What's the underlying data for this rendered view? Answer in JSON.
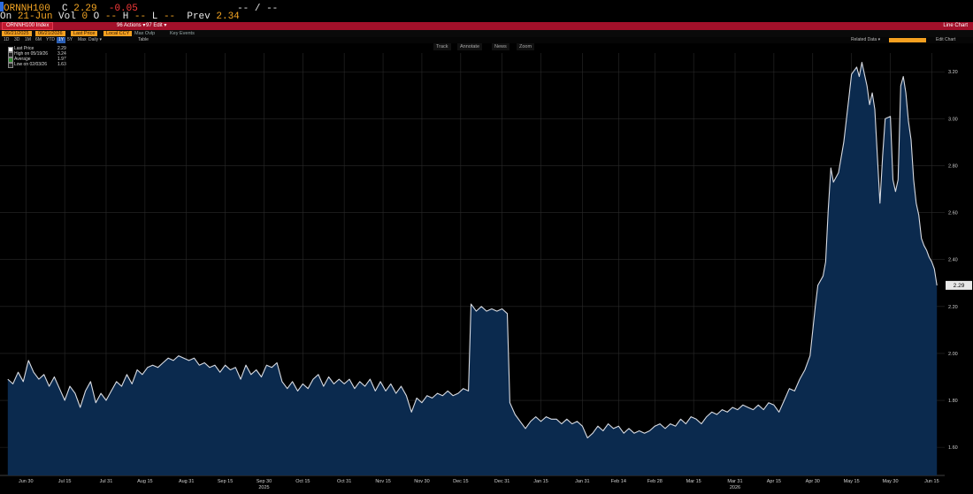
{
  "quote": {
    "ticker": "ORNNH100",
    "c_label": "C",
    "last": "2.29",
    "change": "-0.05",
    "bidask": "-- / --",
    "on_label": "On",
    "date": "21-Jun",
    "vol_label": "Vol",
    "vol": "0",
    "open_label": "O",
    "open": "--",
    "high_label": "H",
    "high": "--",
    "low_label": "L",
    "low": "--",
    "prev_label": "Prev",
    "prev": "2.34"
  },
  "menubar": {
    "ticker_box": "ORNNH100 Index",
    "actions": "96 Actions ▾",
    "edit": "97 Edit ▾",
    "right_title": "Line Chart"
  },
  "dates_row": {
    "start": "06/21/2025",
    "end": "06/21/2026",
    "last_price": "Last Price",
    "local_ccy": "Local CCY",
    "max_ovlp": "Max Ovlp",
    "key_events": "Key Events"
  },
  "periods": [
    "1D",
    "3D",
    "1M",
    "6M",
    "YTD",
    "1Y",
    "5Y",
    "Max",
    "Daily ▾",
    "",
    "Table"
  ],
  "periods_selected_index": 5,
  "right_controls": {
    "related": "Related Data ▾",
    "edit_chart": "Edit Chart"
  },
  "toolbar": [
    "Track",
    "Annotate",
    "News",
    "Zoom"
  ],
  "legend": [
    {
      "label": "Last Price",
      "value": "2.29",
      "color": "#ffffff"
    },
    {
      "label": "High on 05/19/26",
      "value": "3.24",
      "color": "#222222"
    },
    {
      "label": "Average",
      "value": "1.97",
      "color": "#2d8a2d"
    },
    {
      "label": "Low on 02/03/26",
      "value": "1.63",
      "color": "#222222"
    }
  ],
  "colors": {
    "line": "#d8dbe2",
    "fill": "#0b2a4e",
    "last_tag_bg": "#e8e8e8",
    "accent_amber": "#f5a623",
    "change_red": "#ff3b3b"
  },
  "chart_data": {
    "type": "area",
    "title": "",
    "xlabel": "",
    "ylabel": "",
    "ylim": [
      1.48,
      3.28
    ],
    "yticks": [
      1.6,
      1.8,
      2.0,
      2.2,
      2.4,
      2.6,
      2.8,
      3.0,
      3.2
    ],
    "ytick_labels": [
      "1.60",
      "1.80",
      "2.00",
      "2.20",
      "2.40",
      "2.60",
      "2.80",
      "3.00",
      "3.20"
    ],
    "xtick_labels": [
      "Jun 30",
      "Jul 15",
      "Jul 31",
      "Aug 15",
      "Aug 31",
      "Sep 15",
      "Sep 30",
      "Oct 15",
      "Oct 31",
      "Nov 15",
      "Nov 30",
      "Dec 15",
      "Dec 31",
      "Jan 15",
      "Jan 31",
      "Feb 14",
      "Feb 28",
      "Mar 15",
      "Mar 31",
      "Apr 15",
      "Apr 30",
      "May 15",
      "May 30",
      "Jun 15"
    ],
    "xtick_dates": [
      "2025-06-30",
      "2025-07-15",
      "2025-07-31",
      "2025-08-15",
      "2025-08-31",
      "2025-09-15",
      "2025-09-30",
      "2025-10-15",
      "2025-10-31",
      "2025-11-15",
      "2025-11-30",
      "2025-12-15",
      "2025-12-31",
      "2026-01-15",
      "2026-01-31",
      "2026-02-14",
      "2026-02-28",
      "2026-03-15",
      "2026-03-31",
      "2026-04-15",
      "2026-04-30",
      "2026-05-15",
      "2026-05-30",
      "2026-06-15"
    ],
    "year_labels": [
      {
        "label": "2025",
        "date": "2025-09-30"
      },
      {
        "label": "2026",
        "date": "2026-03-31"
      }
    ],
    "last_value_tag": "2.29",
    "series": [
      {
        "values": [
          [
            "2025-06-23",
            1.89
          ],
          [
            "2025-06-25",
            1.87
          ],
          [
            "2025-06-27",
            1.92
          ],
          [
            "2025-06-29",
            1.88
          ],
          [
            "2025-07-01",
            1.97
          ],
          [
            "2025-07-03",
            1.92
          ],
          [
            "2025-07-05",
            1.89
          ],
          [
            "2025-07-07",
            1.91
          ],
          [
            "2025-07-09",
            1.86
          ],
          [
            "2025-07-11",
            1.9
          ],
          [
            "2025-07-13",
            1.85
          ],
          [
            "2025-07-15",
            1.8
          ],
          [
            "2025-07-17",
            1.86
          ],
          [
            "2025-07-19",
            1.83
          ],
          [
            "2025-07-21",
            1.77
          ],
          [
            "2025-07-23",
            1.84
          ],
          [
            "2025-07-25",
            1.88
          ],
          [
            "2025-07-27",
            1.79
          ],
          [
            "2025-07-29",
            1.83
          ],
          [
            "2025-07-31",
            1.8
          ],
          [
            "2025-08-02",
            1.84
          ],
          [
            "2025-08-04",
            1.88
          ],
          [
            "2025-08-06",
            1.86
          ],
          [
            "2025-08-08",
            1.91
          ],
          [
            "2025-08-10",
            1.87
          ],
          [
            "2025-08-12",
            1.93
          ],
          [
            "2025-08-14",
            1.91
          ],
          [
            "2025-08-16",
            1.94
          ],
          [
            "2025-08-18",
            1.95
          ],
          [
            "2025-08-20",
            1.94
          ],
          [
            "2025-08-22",
            1.96
          ],
          [
            "2025-08-24",
            1.98
          ],
          [
            "2025-08-26",
            1.97
          ],
          [
            "2025-08-28",
            1.99
          ],
          [
            "2025-08-30",
            1.98
          ],
          [
            "2025-09-01",
            1.97
          ],
          [
            "2025-09-03",
            1.98
          ],
          [
            "2025-09-05",
            1.95
          ],
          [
            "2025-09-07",
            1.96
          ],
          [
            "2025-09-09",
            1.94
          ],
          [
            "2025-09-11",
            1.95
          ],
          [
            "2025-09-13",
            1.92
          ],
          [
            "2025-09-15",
            1.95
          ],
          [
            "2025-09-17",
            1.93
          ],
          [
            "2025-09-19",
            1.94
          ],
          [
            "2025-09-21",
            1.89
          ],
          [
            "2025-09-23",
            1.95
          ],
          [
            "2025-09-25",
            1.91
          ],
          [
            "2025-09-27",
            1.93
          ],
          [
            "2025-09-29",
            1.9
          ],
          [
            "2025-10-01",
            1.95
          ],
          [
            "2025-10-03",
            1.94
          ],
          [
            "2025-10-05",
            1.96
          ],
          [
            "2025-10-07",
            1.88
          ],
          [
            "2025-10-09",
            1.85
          ],
          [
            "2025-10-11",
            1.88
          ],
          [
            "2025-10-13",
            1.84
          ],
          [
            "2025-10-15",
            1.87
          ],
          [
            "2025-10-17",
            1.85
          ],
          [
            "2025-10-19",
            1.89
          ],
          [
            "2025-10-21",
            1.91
          ],
          [
            "2025-10-23",
            1.86
          ],
          [
            "2025-10-25",
            1.9
          ],
          [
            "2025-10-27",
            1.87
          ],
          [
            "2025-10-29",
            1.89
          ],
          [
            "2025-10-31",
            1.87
          ],
          [
            "2025-11-02",
            1.89
          ],
          [
            "2025-11-04",
            1.85
          ],
          [
            "2025-11-06",
            1.88
          ],
          [
            "2025-11-08",
            1.86
          ],
          [
            "2025-11-10",
            1.89
          ],
          [
            "2025-11-12",
            1.84
          ],
          [
            "2025-11-14",
            1.88
          ],
          [
            "2025-11-16",
            1.84
          ],
          [
            "2025-11-18",
            1.87
          ],
          [
            "2025-11-20",
            1.83
          ],
          [
            "2025-11-22",
            1.86
          ],
          [
            "2025-11-24",
            1.82
          ],
          [
            "2025-11-26",
            1.75
          ],
          [
            "2025-11-28",
            1.81
          ],
          [
            "2025-11-30",
            1.79
          ],
          [
            "2025-12-02",
            1.82
          ],
          [
            "2025-12-04",
            1.81
          ],
          [
            "2025-12-06",
            1.83
          ],
          [
            "2025-12-08",
            1.82
          ],
          [
            "2025-12-10",
            1.84
          ],
          [
            "2025-12-12",
            1.82
          ],
          [
            "2025-12-14",
            1.83
          ],
          [
            "2025-12-16",
            1.85
          ],
          [
            "2025-12-18",
            1.84
          ],
          [
            "2025-12-19",
            2.21
          ],
          [
            "2025-12-21",
            2.18
          ],
          [
            "2025-12-23",
            2.2
          ],
          [
            "2025-12-25",
            2.18
          ],
          [
            "2025-12-27",
            2.19
          ],
          [
            "2025-12-29",
            2.18
          ],
          [
            "2025-12-31",
            2.19
          ],
          [
            "2026-01-02",
            2.17
          ],
          [
            "2026-01-03",
            1.79
          ],
          [
            "2026-01-05",
            1.74
          ],
          [
            "2026-01-07",
            1.71
          ],
          [
            "2026-01-09",
            1.68
          ],
          [
            "2026-01-11",
            1.71
          ],
          [
            "2026-01-13",
            1.73
          ],
          [
            "2026-01-15",
            1.71
          ],
          [
            "2026-01-17",
            1.73
          ],
          [
            "2026-01-19",
            1.72
          ],
          [
            "2026-01-21",
            1.72
          ],
          [
            "2026-01-23",
            1.7
          ],
          [
            "2026-01-25",
            1.72
          ],
          [
            "2026-01-27",
            1.7
          ],
          [
            "2026-01-29",
            1.71
          ],
          [
            "2026-01-31",
            1.69
          ],
          [
            "2026-02-02",
            1.64
          ],
          [
            "2026-02-04",
            1.66
          ],
          [
            "2026-02-06",
            1.69
          ],
          [
            "2026-02-08",
            1.67
          ],
          [
            "2026-02-10",
            1.7
          ],
          [
            "2026-02-12",
            1.68
          ],
          [
            "2026-02-14",
            1.69
          ],
          [
            "2026-02-16",
            1.66
          ],
          [
            "2026-02-18",
            1.68
          ],
          [
            "2026-02-20",
            1.66
          ],
          [
            "2026-02-22",
            1.67
          ],
          [
            "2026-02-24",
            1.66
          ],
          [
            "2026-02-26",
            1.67
          ],
          [
            "2026-02-28",
            1.69
          ],
          [
            "2026-03-02",
            1.7
          ],
          [
            "2026-03-04",
            1.68
          ],
          [
            "2026-03-06",
            1.7
          ],
          [
            "2026-03-08",
            1.69
          ],
          [
            "2026-03-10",
            1.72
          ],
          [
            "2026-03-12",
            1.7
          ],
          [
            "2026-03-14",
            1.73
          ],
          [
            "2026-03-16",
            1.72
          ],
          [
            "2026-03-18",
            1.7
          ],
          [
            "2026-03-20",
            1.73
          ],
          [
            "2026-03-22",
            1.75
          ],
          [
            "2026-03-24",
            1.74
          ],
          [
            "2026-03-26",
            1.76
          ],
          [
            "2026-03-28",
            1.75
          ],
          [
            "2026-03-30",
            1.77
          ],
          [
            "2026-04-01",
            1.76
          ],
          [
            "2026-04-03",
            1.78
          ],
          [
            "2026-04-05",
            1.77
          ],
          [
            "2026-04-07",
            1.76
          ],
          [
            "2026-04-09",
            1.78
          ],
          [
            "2026-04-11",
            1.76
          ],
          [
            "2026-04-13",
            1.79
          ],
          [
            "2026-04-15",
            1.78
          ],
          [
            "2026-04-17",
            1.75
          ],
          [
            "2026-04-19",
            1.8
          ],
          [
            "2026-04-21",
            1.85
          ],
          [
            "2026-04-23",
            1.84
          ],
          [
            "2026-04-25",
            1.89
          ],
          [
            "2026-04-27",
            1.93
          ],
          [
            "2026-04-29",
            1.99
          ],
          [
            "2026-05-01",
            2.2
          ],
          [
            "2026-05-02",
            2.29
          ],
          [
            "2026-05-04",
            2.33
          ],
          [
            "2026-05-05",
            2.39
          ],
          [
            "2026-05-06",
            2.61
          ],
          [
            "2026-05-07",
            2.79
          ],
          [
            "2026-05-08",
            2.73
          ],
          [
            "2026-05-10",
            2.77
          ],
          [
            "2026-05-12",
            2.9
          ],
          [
            "2026-05-14",
            3.09
          ],
          [
            "2026-05-15",
            3.19
          ],
          [
            "2026-05-17",
            3.22
          ],
          [
            "2026-05-18",
            3.18
          ],
          [
            "2026-05-19",
            3.24
          ],
          [
            "2026-05-21",
            3.14
          ],
          [
            "2026-05-22",
            3.06
          ],
          [
            "2026-05-23",
            3.11
          ],
          [
            "2026-05-24",
            3.04
          ],
          [
            "2026-05-25",
            2.84
          ],
          [
            "2026-05-26",
            2.64
          ],
          [
            "2026-05-27",
            2.84
          ],
          [
            "2026-05-28",
            3.0
          ],
          [
            "2026-05-30",
            3.01
          ],
          [
            "2026-05-31",
            2.74
          ],
          [
            "2026-06-01",
            2.69
          ],
          [
            "2026-06-02",
            2.74
          ],
          [
            "2026-06-03",
            3.14
          ],
          [
            "2026-06-04",
            3.18
          ],
          [
            "2026-06-05",
            3.11
          ],
          [
            "2026-06-06",
            2.99
          ],
          [
            "2026-06-07",
            2.91
          ],
          [
            "2026-06-08",
            2.74
          ],
          [
            "2026-06-09",
            2.64
          ],
          [
            "2026-06-10",
            2.59
          ],
          [
            "2026-06-11",
            2.49
          ],
          [
            "2026-06-12",
            2.46
          ],
          [
            "2026-06-13",
            2.44
          ],
          [
            "2026-06-14",
            2.41
          ],
          [
            "2026-06-15",
            2.39
          ],
          [
            "2026-06-16",
            2.36
          ],
          [
            "2026-06-17",
            2.29
          ]
        ]
      }
    ]
  }
}
